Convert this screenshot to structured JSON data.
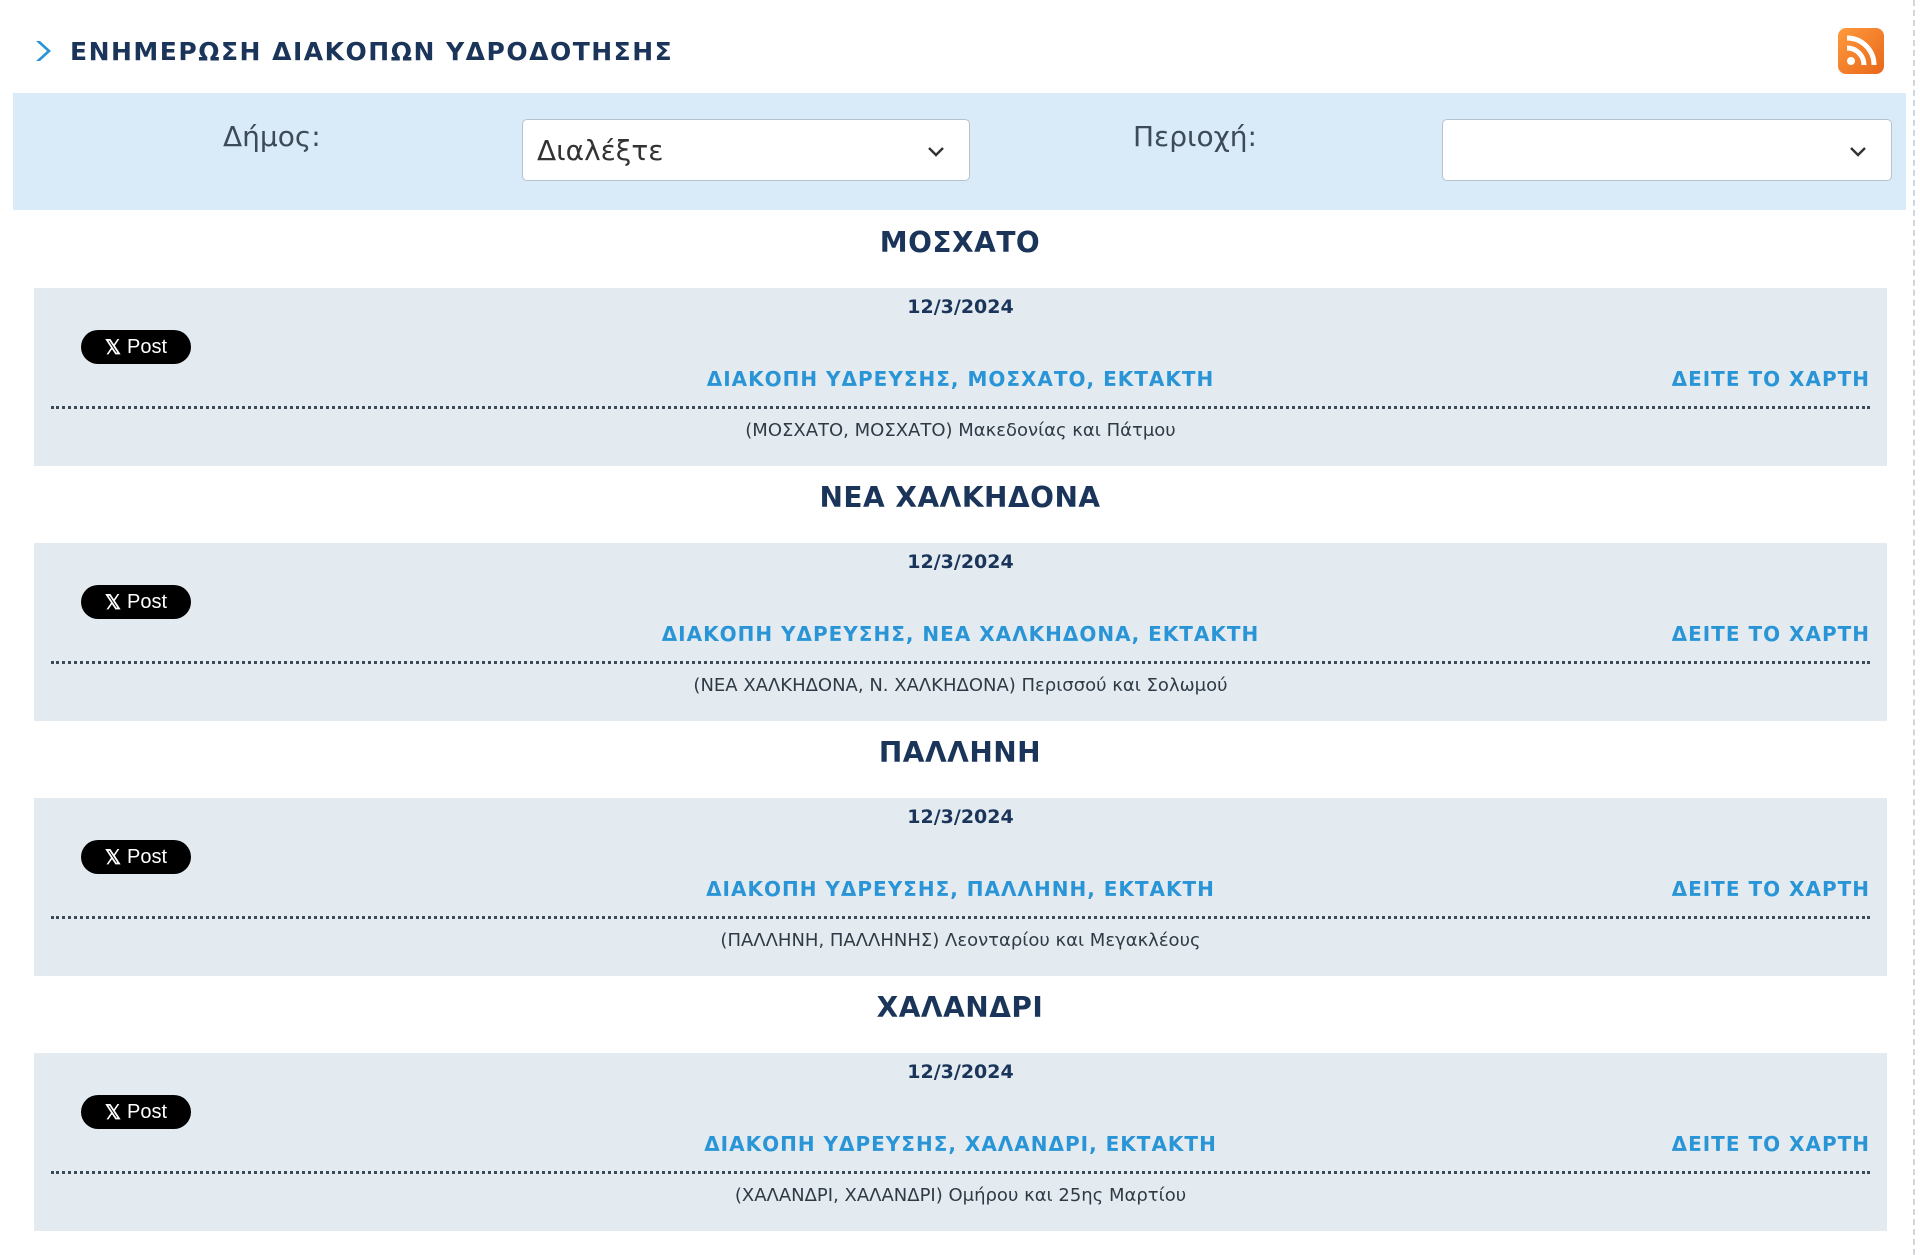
{
  "header": {
    "title": "ΕΝΗΜΕΡΩΣΗ ΔΙΑΚΟΠΩΝ ΥΔΡΟΔΟΤΗΣΗΣ",
    "rss_icon": "rss-icon"
  },
  "filter": {
    "municipality_label": "Δήμος:",
    "municipality_value": "Διαλέξτε",
    "area_label": "Περιοχή:",
    "area_value": ""
  },
  "sections": [
    {
      "title": "ΜΟΣΧΑΤΟ",
      "date": "12/3/2024",
      "post_label": "Post",
      "headline": "ΔΙΑΚΟΠΗ ΥΔΡΕΥΣΗΣ, ΜΟΣΧΑΤΟ, ΕΚΤΑΚΤΗ",
      "map_link": "ΔΕΙΤΕ ΤΟ ΧΑΡΤΗ",
      "description": "(ΜΟΣΧΑΤΟ, ΜΟΣΧΑΤΟ) Μακεδονίας και Πάτμου"
    },
    {
      "title": "ΝΕΑ ΧΑΛΚΗΔΟΝΑ",
      "date": "12/3/2024",
      "post_label": "Post",
      "headline": "ΔΙΑΚΟΠΗ ΥΔΡΕΥΣΗΣ, ΝΕΑ ΧΑΛΚΗΔΟΝΑ, ΕΚΤΑΚΤΗ",
      "map_link": "ΔΕΙΤΕ ΤΟ ΧΑΡΤΗ",
      "description": "(ΝΕΑ ΧΑΛΚΗΔΟΝΑ, Ν. ΧΑΛΚΗΔΟΝΑ) Περισσού και Σολωμού"
    },
    {
      "title": "ΠΑΛΛΗΝΗ",
      "date": "12/3/2024",
      "post_label": "Post",
      "headline": "ΔΙΑΚΟΠΗ ΥΔΡΕΥΣΗΣ, ΠΑΛΛΗΝΗ, ΕΚΤΑΚΤΗ",
      "map_link": "ΔΕΙΤΕ ΤΟ ΧΑΡΤΗ",
      "description": "(ΠΑΛΛΗΝΗ, ΠΑΛΛΗΝΗΣ) Λεονταρίου και Μεγακλέους"
    },
    {
      "title": "ΧΑΛΑΝΔΡΙ",
      "date": "12/3/2024",
      "post_label": "Post",
      "headline": "ΔΙΑΚΟΠΗ ΥΔΡΕΥΣΗΣ, ΧΑΛΑΝΔΡΙ, ΕΚΤΑΚΤΗ",
      "map_link": "ΔΕΙΤΕ ΤΟ ΧΑΡΤΗ",
      "description": "(ΧΑΛΑΝΔΡΙ, ΧΑΛΑΝΔΡΙ) Ομήρου και 25ης Μαρτίου"
    }
  ],
  "colors": {
    "accent_blue": "#2a95d6",
    "title_navy": "#1a3559",
    "filter_bg": "#d9ebf8",
    "card_bg": "#e3ebf1",
    "rss_orange": "#f28a2e"
  }
}
